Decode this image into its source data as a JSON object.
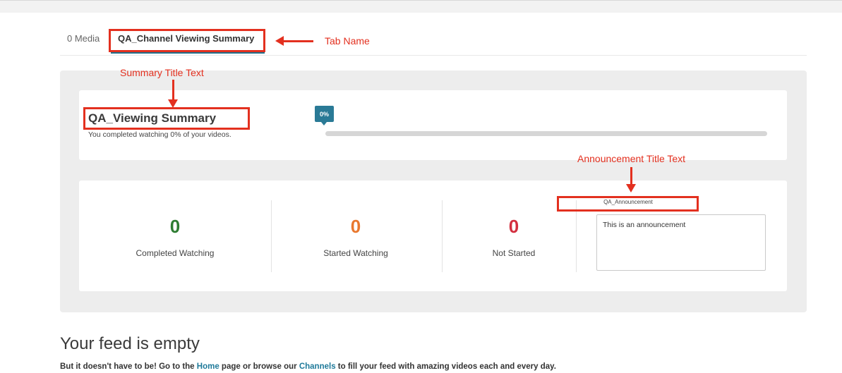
{
  "tabs": [
    {
      "label": "0 Media"
    },
    {
      "label": "QA_Channel Viewing Summary",
      "active": true
    }
  ],
  "summary": {
    "title": "QA_Viewing Summary",
    "subtitle": "You completed watching 0% of your videos.",
    "progress_label": "0%",
    "progress_fraction": 0
  },
  "stats": [
    {
      "value": "0",
      "label": "Completed Watching",
      "color": "#2e7d32"
    },
    {
      "value": "0",
      "label": "Started Watching",
      "color": "#e9782f"
    },
    {
      "value": "0",
      "label": "Not Started",
      "color": "#d32f3f"
    }
  ],
  "announcement": {
    "title": "QA_Announcement",
    "text": "This is an announcement"
  },
  "annotations": {
    "tab_name": "Tab Name",
    "summary_title_text": "Summary Title Text",
    "announcement_title_text": "Announcement Title Text",
    "color": "#e3301f"
  },
  "feed": {
    "title": "Your feed is empty",
    "text_before": "But it doesn't have to be! Go to the ",
    "home_link": "Home",
    "text_middle": " page or browse our ",
    "channels_link": "Channels",
    "text_after": " to fill your feed with amazing videos each and every day."
  },
  "colors": {
    "accent": "#1f6f8b",
    "panel_bg": "#ededed"
  }
}
